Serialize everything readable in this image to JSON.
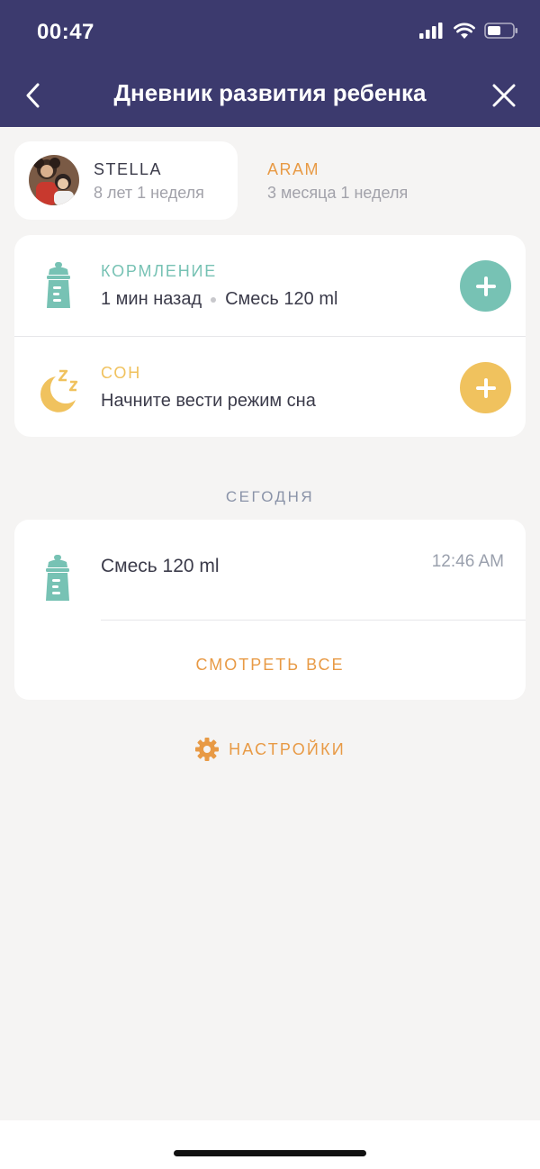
{
  "status_bar": {
    "time": "00:47"
  },
  "nav": {
    "title": "Дневник развития ребенка"
  },
  "profiles": [
    {
      "name": "STELLA",
      "age": "8 лет 1 неделя",
      "selected": true
    },
    {
      "name": "ARAM",
      "age": "3 месяца 1 неделя",
      "selected": false
    }
  ],
  "trackers": {
    "feeding": {
      "label": "КОРМЛЕНИЕ",
      "time_ago": "1 мин назад",
      "detail": "Смесь 120 ml",
      "color": "#77c2b4"
    },
    "sleep": {
      "label": "СОН",
      "detail": "Начните вести режим сна",
      "color": "#f0c25e"
    }
  },
  "today": {
    "section_label": "СЕГОДНЯ",
    "entries": [
      {
        "title": "Смесь 120 ml",
        "time": "12:46 AM",
        "icon": "bottle-icon"
      }
    ],
    "see_all_label": "СМОТРЕТЬ ВСЕ"
  },
  "settings": {
    "label": "НАСТРОЙКИ",
    "icon": "gear-icon"
  },
  "colors": {
    "header": "#3c3a6e",
    "accent_orange": "#e89a45",
    "teal": "#77c2b4",
    "yellow": "#f0c25e",
    "background": "#f5f4f3"
  }
}
